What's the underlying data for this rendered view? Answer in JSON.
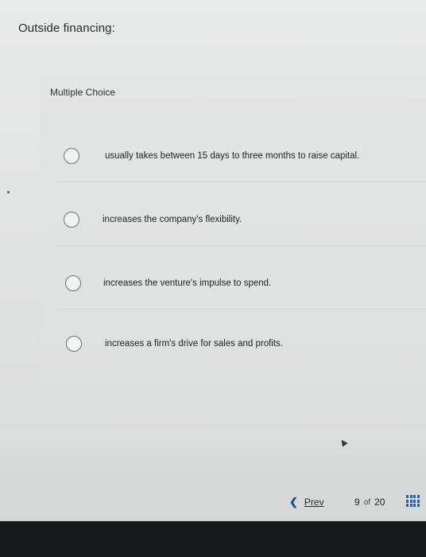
{
  "question": {
    "prompt": "Outside financing:",
    "type_label": "Multiple Choice",
    "options": [
      {
        "label": "usually takes between 15 days to three months to raise capital."
      },
      {
        "label": "increases the company's flexibility."
      },
      {
        "label": "increases the venture's impulse to spend."
      },
      {
        "label": "increases a firm's drive for sales and profits."
      }
    ]
  },
  "navigation": {
    "prev_label": "Prev",
    "current_page": "9",
    "of_label": "of",
    "total_pages": "20",
    "grid_icon": "grid-icon",
    "prev_icon": "chevron-left-icon"
  },
  "colors": {
    "accent": "#2b5db0",
    "bottom_bar": "#17181a"
  }
}
